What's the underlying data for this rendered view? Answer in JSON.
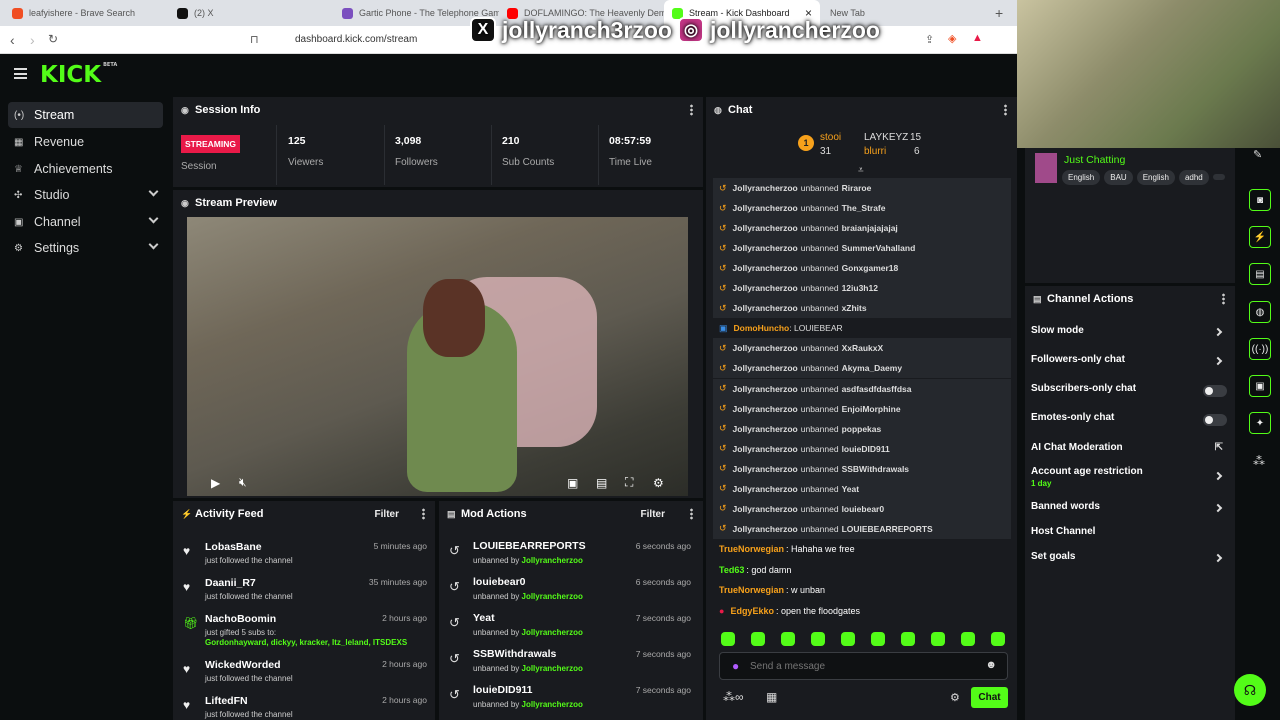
{
  "browser": {
    "tabs": [
      {
        "label": "leafyishere - Brave Search",
        "color": "#f04e23"
      },
      {
        "label": "(2) X",
        "color": "#111111"
      },
      {
        "label": "Gartic Phone - The Telephone Game",
        "color": "#7b4fbf"
      },
      {
        "label": "DOFLAMINGO: The Heavenly Demon",
        "color": "#ff0000"
      },
      {
        "label": "Stream - Kick Dashboard",
        "color": "#53fc18"
      },
      {
        "label": "New Tab",
        "color": "#bbbbbb"
      }
    ],
    "url": "dashboard.kick.com/stream",
    "new_tab_label": "+",
    "close_label": "×"
  },
  "overlay": {
    "x_handle": "jollyranch3rzoo",
    "ig_handle": "jollyrancherzoo"
  },
  "app": {
    "logo": "KICK",
    "logo_badge": "BETA"
  },
  "sidebar": {
    "items": [
      {
        "label": "Stream",
        "icon": "broadcast-icon"
      },
      {
        "label": "Revenue",
        "icon": "revenue-icon"
      },
      {
        "label": "Achievements",
        "icon": "trophy-icon"
      },
      {
        "label": "Studio",
        "icon": "studio-icon"
      },
      {
        "label": "Channel",
        "icon": "channel-icon"
      },
      {
        "label": "Settings",
        "icon": "gear-icon"
      }
    ]
  },
  "session_info": {
    "title": "Session Info",
    "status_badge": "STREAMING",
    "session_label": "Session",
    "stats": [
      {
        "value": "125",
        "label": "Viewers"
      },
      {
        "value": "3,098",
        "label": "Followers"
      },
      {
        "value": "210",
        "label": "Sub Counts"
      },
      {
        "value": "08:57:59",
        "label": "Time Live"
      }
    ]
  },
  "stream_preview": {
    "title": "Stream Preview"
  },
  "activity_feed": {
    "title": "Activity Feed",
    "filter_label": "Filter",
    "items": [
      {
        "name": "LobasBane",
        "sub": "just followed the channel",
        "time": "5 minutes ago"
      },
      {
        "name": "Daanii_R7",
        "sub": "just followed the channel",
        "time": "35 minutes ago"
      },
      {
        "name": "NachoBoomin",
        "sub": "just gifted 5 subs to:",
        "recipients": "Gordonhayward, dickyy, kracker, Itz_leland, ITSDEXS",
        "time": "2 hours ago"
      },
      {
        "name": "WickedWorded",
        "sub": "just followed the channel",
        "time": "2 hours ago"
      },
      {
        "name": "LiftedFN",
        "sub": "just followed the channel",
        "time": "2 hours ago"
      }
    ]
  },
  "mod_actions": {
    "title": "Mod Actions",
    "filter_label": "Filter",
    "items": [
      {
        "name": "LOUIEBEARREPORTS",
        "by": "unbanned by",
        "mod": "Jollyrancherzoo",
        "time": "6 seconds ago"
      },
      {
        "name": "louiebear0",
        "by": "unbanned by",
        "mod": "Jollyrancherzoo",
        "time": "6 seconds ago"
      },
      {
        "name": "Yeat",
        "by": "unbanned by",
        "mod": "Jollyrancherzoo",
        "time": "7 seconds ago"
      },
      {
        "name": "SSBWithdrawals",
        "by": "unbanned by",
        "mod": "Jollyrancherzoo",
        "time": "7 seconds ago"
      },
      {
        "name": "louieDID911",
        "by": "unbanned by",
        "mod": "Jollyrancherzoo",
        "time": "7 seconds ago"
      }
    ]
  },
  "chat": {
    "title": "Chat",
    "leaderboard": [
      {
        "name": "stooi",
        "count": "31"
      },
      {
        "name": "LAYKEYZ",
        "count": "15"
      },
      {
        "name": "blurri",
        "count": "6"
      }
    ],
    "rank_badge": "1",
    "system": [
      {
        "actor": "Jollyrancherzoo",
        "action": "unbanned",
        "target": "Riraroe"
      },
      {
        "actor": "Jollyrancherzoo",
        "action": "unbanned",
        "target": "The_Strafe"
      },
      {
        "actor": "Jollyrancherzoo",
        "action": "unbanned",
        "target": "braianjajajajaj"
      },
      {
        "actor": "Jollyrancherzoo",
        "action": "unbanned",
        "target": "SummerVahalland"
      },
      {
        "actor": "Jollyrancherzoo",
        "action": "unbanned",
        "target": "Gonxgamer18"
      },
      {
        "actor": "Jollyrancherzoo",
        "action": "unbanned",
        "target": "12iu3h12"
      },
      {
        "actor": "Jollyrancherzoo",
        "action": "unbanned",
        "target": "xZhits"
      }
    ],
    "domo": {
      "name": "DomoHuncho",
      "text": "LOUIEBEAR"
    },
    "system2": [
      {
        "actor": "Jollyrancherzoo",
        "action": "unbanned",
        "target": "XxRaukxX"
      },
      {
        "actor": "Jollyrancherzoo",
        "action": "unbanned",
        "target": "Akyma_Daemy"
      },
      {
        "actor": "Jollyrancherzoo",
        "action": "unbanned",
        "target": "asdfasdfdasffdsa"
      },
      {
        "actor": "Jollyrancherzoo",
        "action": "unbanned",
        "target": "EnjoiMorphine"
      },
      {
        "actor": "Jollyrancherzoo",
        "action": "unbanned",
        "target": "poppekas"
      },
      {
        "actor": "Jollyrancherzoo",
        "action": "unbanned",
        "target": "louieDID911"
      },
      {
        "actor": "Jollyrancherzoo",
        "action": "unbanned",
        "target": "SSBWithdrawals"
      },
      {
        "actor": "Jollyrancherzoo",
        "action": "unbanned",
        "target": "Yeat"
      },
      {
        "actor": "Jollyrancherzoo",
        "action": "unbanned",
        "target": "louiebear0"
      },
      {
        "actor": "Jollyrancherzoo",
        "action": "unbanned",
        "target": "LOUIEBEARREPORTS"
      }
    ],
    "messages": [
      {
        "user": "TrueNorwegian",
        "text": "Hahaha we free",
        "color": "#f7a11b"
      },
      {
        "user": "Ted63",
        "text": "god damn",
        "color": "#53fc18"
      },
      {
        "user": "TrueNorwegian",
        "text": "w unban",
        "color": "#f7a11b"
      },
      {
        "user": "EdgyEkko",
        "text": "open the floodgates",
        "color": "#f7a11b"
      }
    ],
    "placeholder": "Send a message",
    "send_label": "Chat"
  },
  "category": {
    "name": "Just Chatting",
    "tags": [
      "English",
      "BAU",
      "English",
      "adhd"
    ]
  },
  "channel_actions": {
    "title": "Channel Actions",
    "items": [
      {
        "label": "Slow mode",
        "control": "arrow"
      },
      {
        "label": "Followers-only chat",
        "control": "arrow"
      },
      {
        "label": "Subscribers-only chat",
        "control": "toggle"
      },
      {
        "label": "Emotes-only chat",
        "control": "toggle"
      },
      {
        "label": "AI Chat Moderation",
        "control": "external"
      },
      {
        "label": "Account age restriction",
        "sub": "1 day",
        "control": "arrow"
      },
      {
        "label": "Banned words",
        "control": "arrow"
      },
      {
        "label": "Host Channel",
        "control": "none"
      },
      {
        "label": "Set goals",
        "control": "arrow"
      }
    ]
  },
  "colors": {
    "accent": "#53fc18",
    "live": "#e91a48",
    "panel": "#191b1f",
    "bg": "#0b0e0f"
  }
}
